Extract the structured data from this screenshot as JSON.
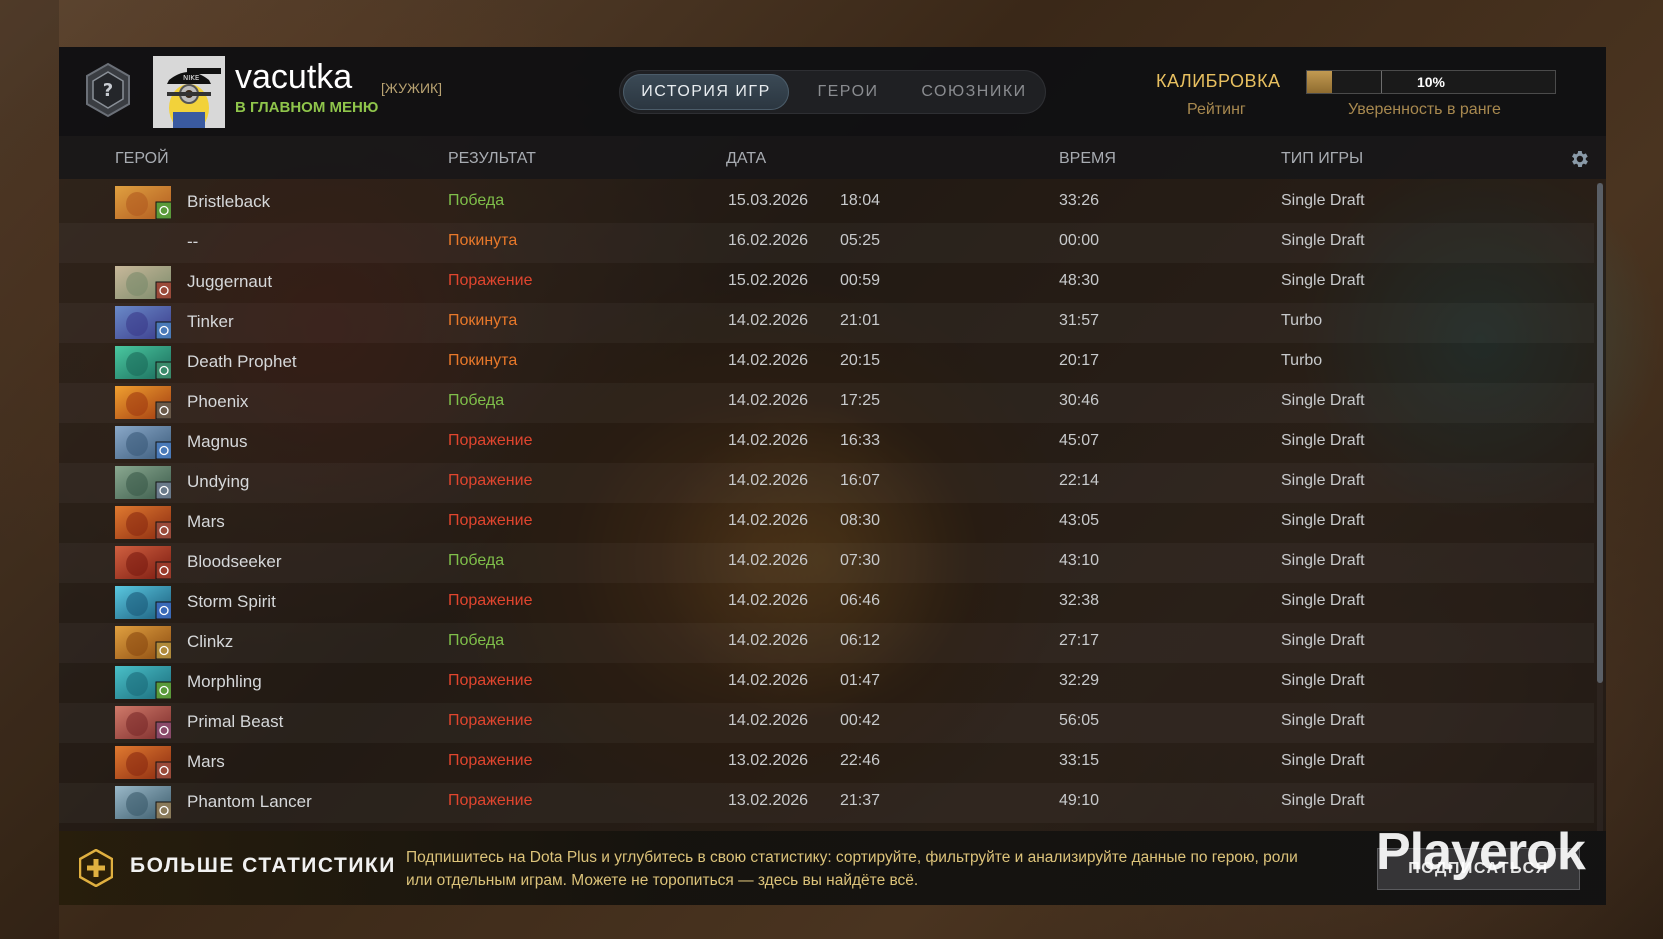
{
  "profile": {
    "username": "vacutka",
    "tag": "[ЖУЖИК]",
    "status": "В ГЛАВНОМ МЕНЮ"
  },
  "tabs": [
    {
      "label": "ИСТОРИЯ ИГР",
      "active": true
    },
    {
      "label": "ГЕРОИ",
      "active": false
    },
    {
      "label": "СОЮЗНИКИ",
      "active": false
    }
  ],
  "calibration": {
    "title": "КАЛИБРОВКА",
    "rating_label": "Рейтинг",
    "confidence_value": "10%",
    "confidence_fraction": 0.1,
    "confidence_label": "Уверенность в ранге"
  },
  "columns": {
    "hero": "ГЕРОЙ",
    "result": "РЕЗУЛЬТАТ",
    "date": "ДАТА",
    "duration": "ВРЕМЯ",
    "mode": "ТИП ИГРЫ"
  },
  "colors": {
    "win": "#7fbf4a",
    "loss": "#e0452e",
    "abandon": "#e8782a",
    "accent": "#e8c060"
  },
  "matches": [
    {
      "hero": "Bristleback",
      "result": "Победа",
      "rtype": "win",
      "date": "15.03.2026",
      "time": "18:04",
      "duration": "33:26",
      "mode": "Single Draft",
      "c1": "#b05a20",
      "c2": "#e0a040",
      "badge": "#5a9a3a"
    },
    {
      "hero": "--",
      "result": "Покинута",
      "rtype": "abandon",
      "date": "16.02.2026",
      "time": "05:25",
      "duration": "00:00",
      "mode": "Single Draft",
      "c1": "",
      "c2": "",
      "badge": ""
    },
    {
      "hero": "Juggernaut",
      "result": "Поражение",
      "rtype": "loss",
      "date": "15.02.2026",
      "time": "00:59",
      "duration": "48:30",
      "mode": "Single Draft",
      "c1": "#7a8a6a",
      "c2": "#c8b89a",
      "badge": "#9a4a3a"
    },
    {
      "hero": "Tinker",
      "result": "Покинута",
      "rtype": "abandon",
      "date": "14.02.2026",
      "time": "21:01",
      "duration": "31:57",
      "mode": "Turbo",
      "c1": "#3a3a8a",
      "c2": "#6a8ac8",
      "badge": "#4a7ab8"
    },
    {
      "hero": "Death Prophet",
      "result": "Покинута",
      "rtype": "abandon",
      "date": "14.02.2026",
      "time": "20:15",
      "duration": "20:17",
      "mode": "Turbo",
      "c1": "#1a6a5a",
      "c2": "#4ac8a0",
      "badge": "#3a8a6a"
    },
    {
      "hero": "Phoenix",
      "result": "Победа",
      "rtype": "win",
      "date": "14.02.2026",
      "time": "17:25",
      "duration": "30:46",
      "mode": "Single Draft",
      "c1": "#a03a10",
      "c2": "#f0a030",
      "badge": "#6a5a4a"
    },
    {
      "hero": "Magnus",
      "result": "Поражение",
      "rtype": "loss",
      "date": "14.02.2026",
      "time": "16:33",
      "duration": "45:07",
      "mode": "Single Draft",
      "c1": "#3a5a7a",
      "c2": "#8aa8c8",
      "badge": "#4a7ab8"
    },
    {
      "hero": "Undying",
      "result": "Поражение",
      "rtype": "loss",
      "date": "14.02.2026",
      "time": "16:07",
      "duration": "22:14",
      "mode": "Single Draft",
      "c1": "#3a5a4a",
      "c2": "#8aa890",
      "badge": "#6a7a8a"
    },
    {
      "hero": "Mars",
      "result": "Поражение",
      "rtype": "loss",
      "date": "14.02.2026",
      "time": "08:30",
      "duration": "43:05",
      "mode": "Single Draft",
      "c1": "#8a2a10",
      "c2": "#e07a30",
      "badge": "#9a4a3a"
    },
    {
      "hero": "Bloodseeker",
      "result": "Победа",
      "rtype": "win",
      "date": "14.02.2026",
      "time": "07:30",
      "duration": "43:10",
      "mode": "Single Draft",
      "c1": "#7a1a10",
      "c2": "#d06040",
      "badge": "#9a3a2a"
    },
    {
      "hero": "Storm Spirit",
      "result": "Поражение",
      "rtype": "loss",
      "date": "14.02.2026",
      "time": "06:46",
      "duration": "32:38",
      "mode": "Single Draft",
      "c1": "#1a5a7a",
      "c2": "#5ac8e0",
      "badge": "#3a6ab8"
    },
    {
      "hero": "Clinkz",
      "result": "Победа",
      "rtype": "win",
      "date": "14.02.2026",
      "time": "06:12",
      "duration": "27:17",
      "mode": "Single Draft",
      "c1": "#8a4a10",
      "c2": "#e0a040",
      "badge": "#b08a3a"
    },
    {
      "hero": "Morphling",
      "result": "Поражение",
      "rtype": "loss",
      "date": "14.02.2026",
      "time": "01:47",
      "duration": "32:29",
      "mode": "Single Draft",
      "c1": "#1a6a7a",
      "c2": "#4ac0c8",
      "badge": "#5a9a3a"
    },
    {
      "hero": "Primal Beast",
      "result": "Поражение",
      "rtype": "loss",
      "date": "14.02.2026",
      "time": "00:42",
      "duration": "56:05",
      "mode": "Single Draft",
      "c1": "#7a2a2a",
      "c2": "#d07a6a",
      "badge": "#8a4a6a"
    },
    {
      "hero": "Mars",
      "result": "Поражение",
      "rtype": "loss",
      "date": "13.02.2026",
      "time": "22:46",
      "duration": "33:15",
      "mode": "Single Draft",
      "c1": "#8a2a10",
      "c2": "#e07a30",
      "badge": "#9a4a3a"
    },
    {
      "hero": "Phantom Lancer",
      "result": "Поражение",
      "rtype": "loss",
      "date": "13.02.2026",
      "time": "21:37",
      "duration": "49:10",
      "mode": "Single Draft",
      "c1": "#3a5a6a",
      "c2": "#9ab8c8",
      "badge": "#8a7a5a"
    }
  ],
  "footer": {
    "title": "БОЛЬШЕ СТАТИСТИКИ",
    "text": "Подпишитесь на Dota Plus и углубитесь в свою статистику: сортируйте, фильтруйте и анализируйте данные по герою, роли или отдельным играм. Можете не торопиться — здесь вы найдёте всё.",
    "button": "ПОДПИСАТЬСЯ"
  },
  "watermark": "Playerok"
}
